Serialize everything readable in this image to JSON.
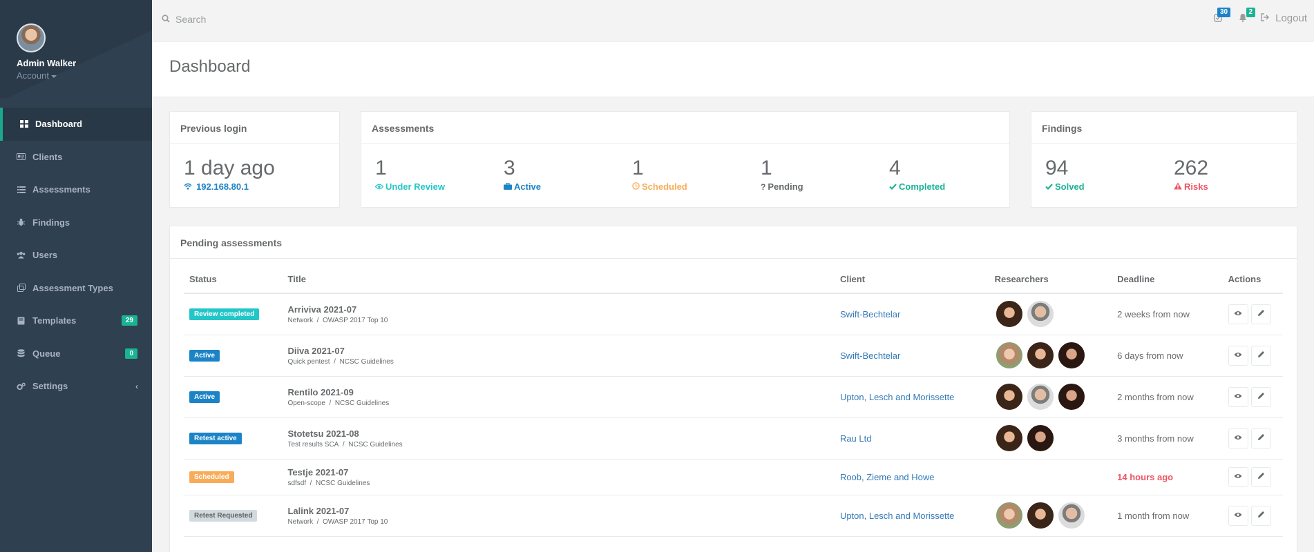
{
  "sidebar": {
    "user_name": "Admin Walker",
    "account_label": "Account",
    "items": [
      {
        "label": "Dashboard",
        "icon": "dashboard-icon",
        "active": true
      },
      {
        "label": "Clients",
        "icon": "id-card-icon"
      },
      {
        "label": "Assessments",
        "icon": "list-icon"
      },
      {
        "label": "Findings",
        "icon": "bug-icon"
      },
      {
        "label": "Users",
        "icon": "users-icon"
      },
      {
        "label": "Assessment Types",
        "icon": "clone-icon"
      },
      {
        "label": "Templates",
        "icon": "book-icon",
        "badge": "29"
      },
      {
        "label": "Queue",
        "icon": "database-icon",
        "badge": "0"
      },
      {
        "label": "Settings",
        "icon": "cogs-icon",
        "arrow": "‹"
      }
    ]
  },
  "topbar": {
    "search_placeholder": "Search",
    "tasks_badge": "30",
    "notifications_badge": "2",
    "logout_label": "Logout"
  },
  "page": {
    "title": "Dashboard"
  },
  "previous_login": {
    "title": "Previous login",
    "value": "1 day ago",
    "ip": "192.168.80.1"
  },
  "assessments_summary": {
    "title": "Assessments",
    "stats": [
      {
        "value": "1",
        "label": "Under Review",
        "icon": "eye-icon",
        "color": "#23c6c8"
      },
      {
        "value": "3",
        "label": "Active",
        "icon": "briefcase-icon",
        "color": "#1c84c6"
      },
      {
        "value": "1",
        "label": "Scheduled",
        "icon": "clock-icon",
        "color": "#f8ac59"
      },
      {
        "value": "1",
        "label": "Pending",
        "icon": "question-icon",
        "color": "#676a6c"
      },
      {
        "value": "4",
        "label": "Completed",
        "icon": "check-icon",
        "color": "#1ab394"
      }
    ]
  },
  "findings_summary": {
    "title": "Findings",
    "stats": [
      {
        "value": "94",
        "label": "Solved",
        "icon": "check-icon",
        "color": "#1ab394"
      },
      {
        "value": "262",
        "label": "Risks",
        "icon": "warning-icon",
        "color": "#ed5565"
      }
    ]
  },
  "pending": {
    "title": "Pending assessments",
    "columns": [
      "Status",
      "Title",
      "Client",
      "Researchers",
      "Deadline",
      "Actions"
    ],
    "rows": [
      {
        "status": "Review completed",
        "status_color": "#23c6c8",
        "title": "Arriviva 2021-07",
        "type": "Network",
        "standard": "OWASP 2017 Top 10",
        "client": "Swift-Bechtelar",
        "researchers": [
          "woman-1",
          "man-1"
        ],
        "deadline": "2 weeks from now",
        "overdue": false
      },
      {
        "status": "Active",
        "status_color": "#1c84c6",
        "title": "Diiva 2021-07",
        "type": "Quick pentest",
        "standard": "NCSC Guidelines",
        "client": "Swift-Bechtelar",
        "researchers": [
          "woman-2",
          "woman-1",
          "woman-3"
        ],
        "deadline": "6 days from now",
        "overdue": false
      },
      {
        "status": "Active",
        "status_color": "#1c84c6",
        "title": "Rentilo 2021-09",
        "type": "Open-scope",
        "standard": "NCSC Guidelines",
        "client": "Upton, Lesch and Morissette",
        "researchers": [
          "woman-1",
          "man-1",
          "woman-3"
        ],
        "deadline": "2 months from now",
        "overdue": false
      },
      {
        "status": "Retest active",
        "status_color": "#1c84c6",
        "title": "Stotetsu 2021-08",
        "type": "Test results SCA",
        "standard": "NCSC Guidelines",
        "client": "Rau Ltd",
        "researchers": [
          "woman-1",
          "woman-3"
        ],
        "deadline": "3 months from now",
        "overdue": false
      },
      {
        "status": "Scheduled",
        "status_color": "#f8ac59",
        "title": "Testje 2021-07",
        "type": "sdfsdf",
        "standard": "NCSC Guidelines",
        "client": "Roob, Zieme and Howe",
        "researchers": [],
        "deadline": "14 hours ago",
        "overdue": true
      },
      {
        "status": "Retest Requested",
        "status_color": "#d1dade",
        "title": "Lalink 2021-07",
        "type": "Network",
        "standard": "OWASP 2017 Top 10",
        "client": "Upton, Lesch and Morissette",
        "researchers": [
          "woman-2",
          "woman-1",
          "man-1"
        ],
        "deadline": "1 month from now",
        "overdue": false
      }
    ]
  }
}
